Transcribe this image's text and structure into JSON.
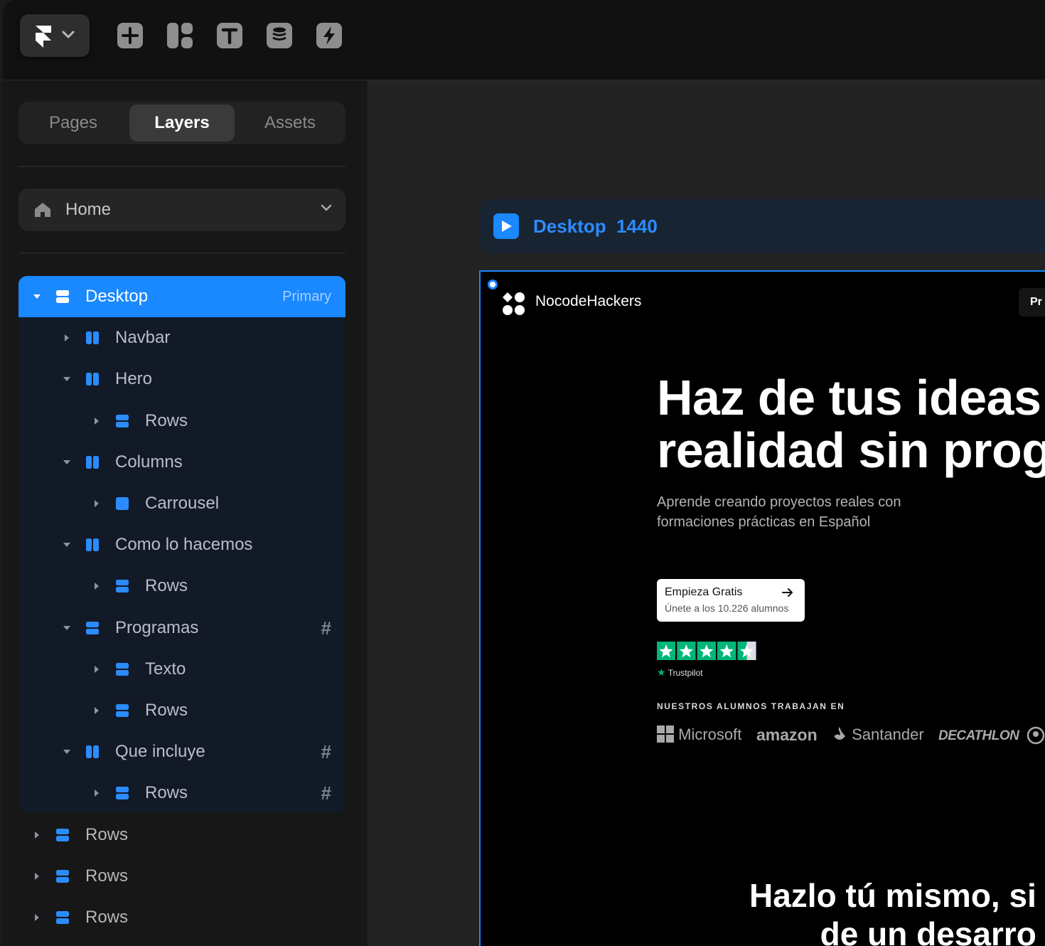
{
  "toolbar": {
    "tools": [
      "insert-icon",
      "layout-icon",
      "text-icon",
      "cms-icon",
      "interactions-icon"
    ]
  },
  "panel": {
    "tabs": [
      {
        "label": "Pages"
      },
      {
        "label": "Layers",
        "active": true
      },
      {
        "label": "Assets"
      }
    ],
    "page_select": {
      "label": "Home"
    },
    "layers": [
      {
        "name": "Desktop",
        "badge": "Primary",
        "icon": "stack-icon",
        "expanded": true,
        "selected": true
      },
      {
        "name": "Navbar",
        "icon": "columns-icon",
        "expanded": false
      },
      {
        "name": "Hero",
        "icon": "columns-icon",
        "expanded": true
      },
      {
        "name": "Rows",
        "icon": "stack-icon",
        "expanded": false
      },
      {
        "name": "Columns",
        "icon": "columns-icon",
        "expanded": true
      },
      {
        "name": "Carrousel",
        "icon": "frame-icon",
        "expanded": false
      },
      {
        "name": "Como lo hacemos",
        "icon": "columns-icon",
        "expanded": true
      },
      {
        "name": "Rows",
        "icon": "stack-icon",
        "expanded": false
      },
      {
        "name": "Programas",
        "icon": "stack-icon",
        "expanded": true,
        "grid": "#"
      },
      {
        "name": "Texto",
        "icon": "stack-icon",
        "expanded": false
      },
      {
        "name": "Rows",
        "icon": "stack-icon",
        "expanded": false
      },
      {
        "name": "Que incluye",
        "icon": "columns-icon",
        "expanded": true,
        "grid": "#"
      },
      {
        "name": "Rows",
        "icon": "stack-icon",
        "expanded": false,
        "grid": "#"
      },
      {
        "name": "Rows",
        "icon": "stack-icon",
        "expanded": false
      },
      {
        "name": "Rows",
        "icon": "stack-icon",
        "expanded": false
      },
      {
        "name": "Rows",
        "icon": "stack-icon",
        "expanded": false
      }
    ]
  },
  "canvas": {
    "breakpoint": {
      "name": "Desktop",
      "width": "1440"
    },
    "site": {
      "brand": "NocodeHackers",
      "nav_button": "Pr",
      "hero_title": "Haz de tus ideas\nrealidad sin prog",
      "hero_subtitle": "Aprende creando proyectos reales con formaciones prácticas en Español",
      "cta_label": "Empieza Gratis",
      "cta_sub": "Únete a los 10.226 alumnos",
      "trustpilot_label": "Trustpilot",
      "trustpilot_rating": 4.5,
      "alumni_heading": "NUESTROS ALUMNOS TRABAJAN EN",
      "logos": [
        "Microsoft",
        "amazon",
        "Santander",
        "DECATHLON"
      ],
      "section_title": "Hazlo tú mismo, si\nde un desarro"
    }
  },
  "colors": {
    "accent": "#1a88ff",
    "tree_bg": "#121a27",
    "trustpilot_green": "#00b67a"
  }
}
